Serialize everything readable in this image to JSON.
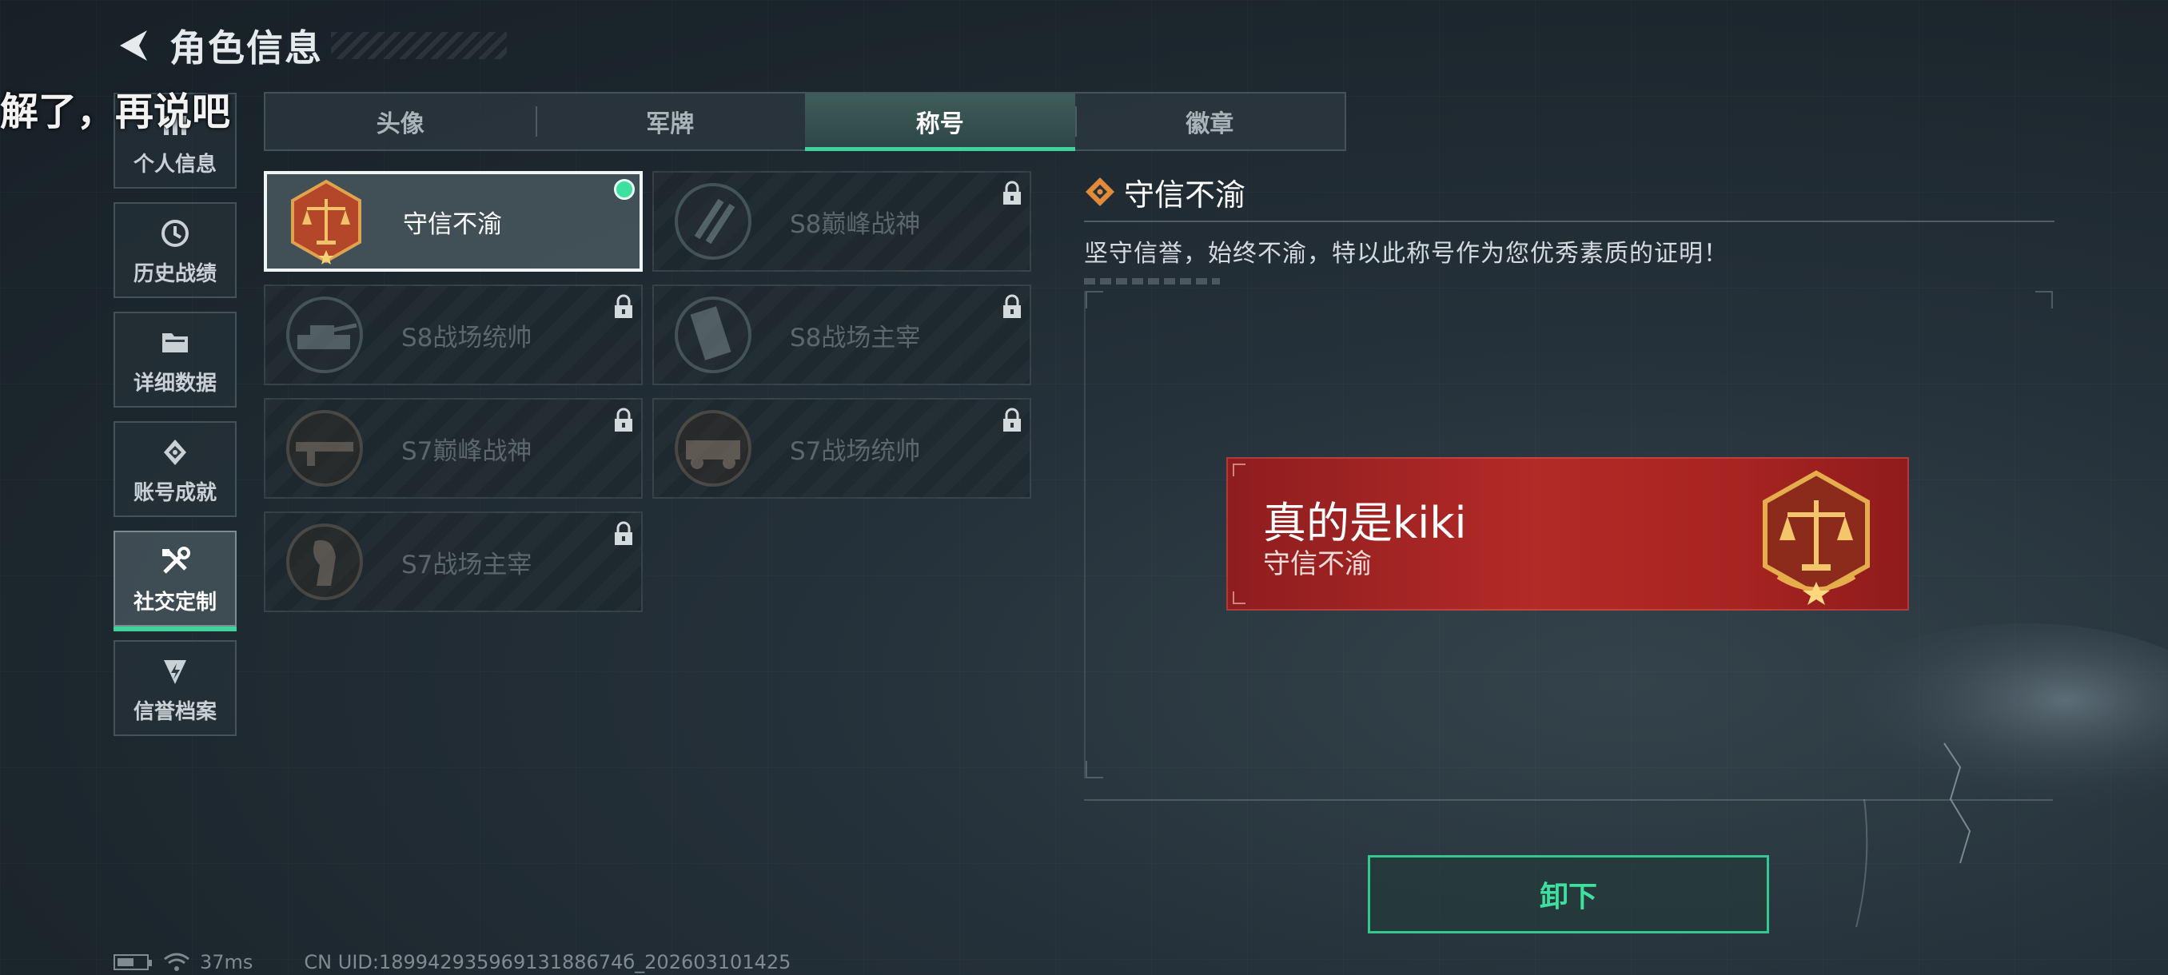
{
  "header": {
    "title": "角色信息"
  },
  "overlay_text": "解了，再说吧",
  "sidebar": {
    "items": [
      {
        "label": "个人信息",
        "icon": "profile-icon",
        "active": false
      },
      {
        "label": "历史战绩",
        "icon": "history-icon",
        "active": false
      },
      {
        "label": "详细数据",
        "icon": "folder-icon",
        "active": false
      },
      {
        "label": "账号成就",
        "icon": "achievement-icon",
        "active": false
      },
      {
        "label": "社交定制",
        "icon": "tools-icon",
        "active": true
      },
      {
        "label": "信誉档案",
        "icon": "shield-icon",
        "active": false
      }
    ]
  },
  "tabs": [
    {
      "label": "头像",
      "active": false
    },
    {
      "label": "军牌",
      "active": false
    },
    {
      "label": "称号",
      "active": true
    },
    {
      "label": "徽章",
      "active": false
    }
  ],
  "titles": [
    {
      "label": "守信不渝",
      "locked": false,
      "selected": true,
      "emblem": "scales-emblem"
    },
    {
      "label": "S8巅峰战神",
      "locked": true,
      "selected": false,
      "emblem": "slash-emblem"
    },
    {
      "label": "S8战场统帅",
      "locked": true,
      "selected": false,
      "emblem": "tank-emblem"
    },
    {
      "label": "S8战场主宰",
      "locked": true,
      "selected": false,
      "emblem": "building-emblem"
    },
    {
      "label": "S7巅峰战神",
      "locked": true,
      "selected": false,
      "emblem": "gun-emblem"
    },
    {
      "label": "S7战场统帅",
      "locked": true,
      "selected": false,
      "emblem": "vehicle-emblem"
    },
    {
      "label": "S7战场主宰",
      "locked": true,
      "selected": false,
      "emblem": "soldier-emblem"
    }
  ],
  "detail": {
    "title": "守信不渝",
    "description": "坚守信誉，始终不渝，特以此称号作为您优秀素质的证明！"
  },
  "preview": {
    "player_name": "真的是kiki",
    "title": "守信不渝"
  },
  "actions": {
    "unequip_label": "卸下"
  },
  "status_bar": {
    "ping": "37ms",
    "uid": "CN UID:18994293596913188674б_202603101425"
  },
  "colors": {
    "accent": "#3ed39a",
    "preview_bg": "#b32a27",
    "emblem_gold": "#d9a441"
  }
}
